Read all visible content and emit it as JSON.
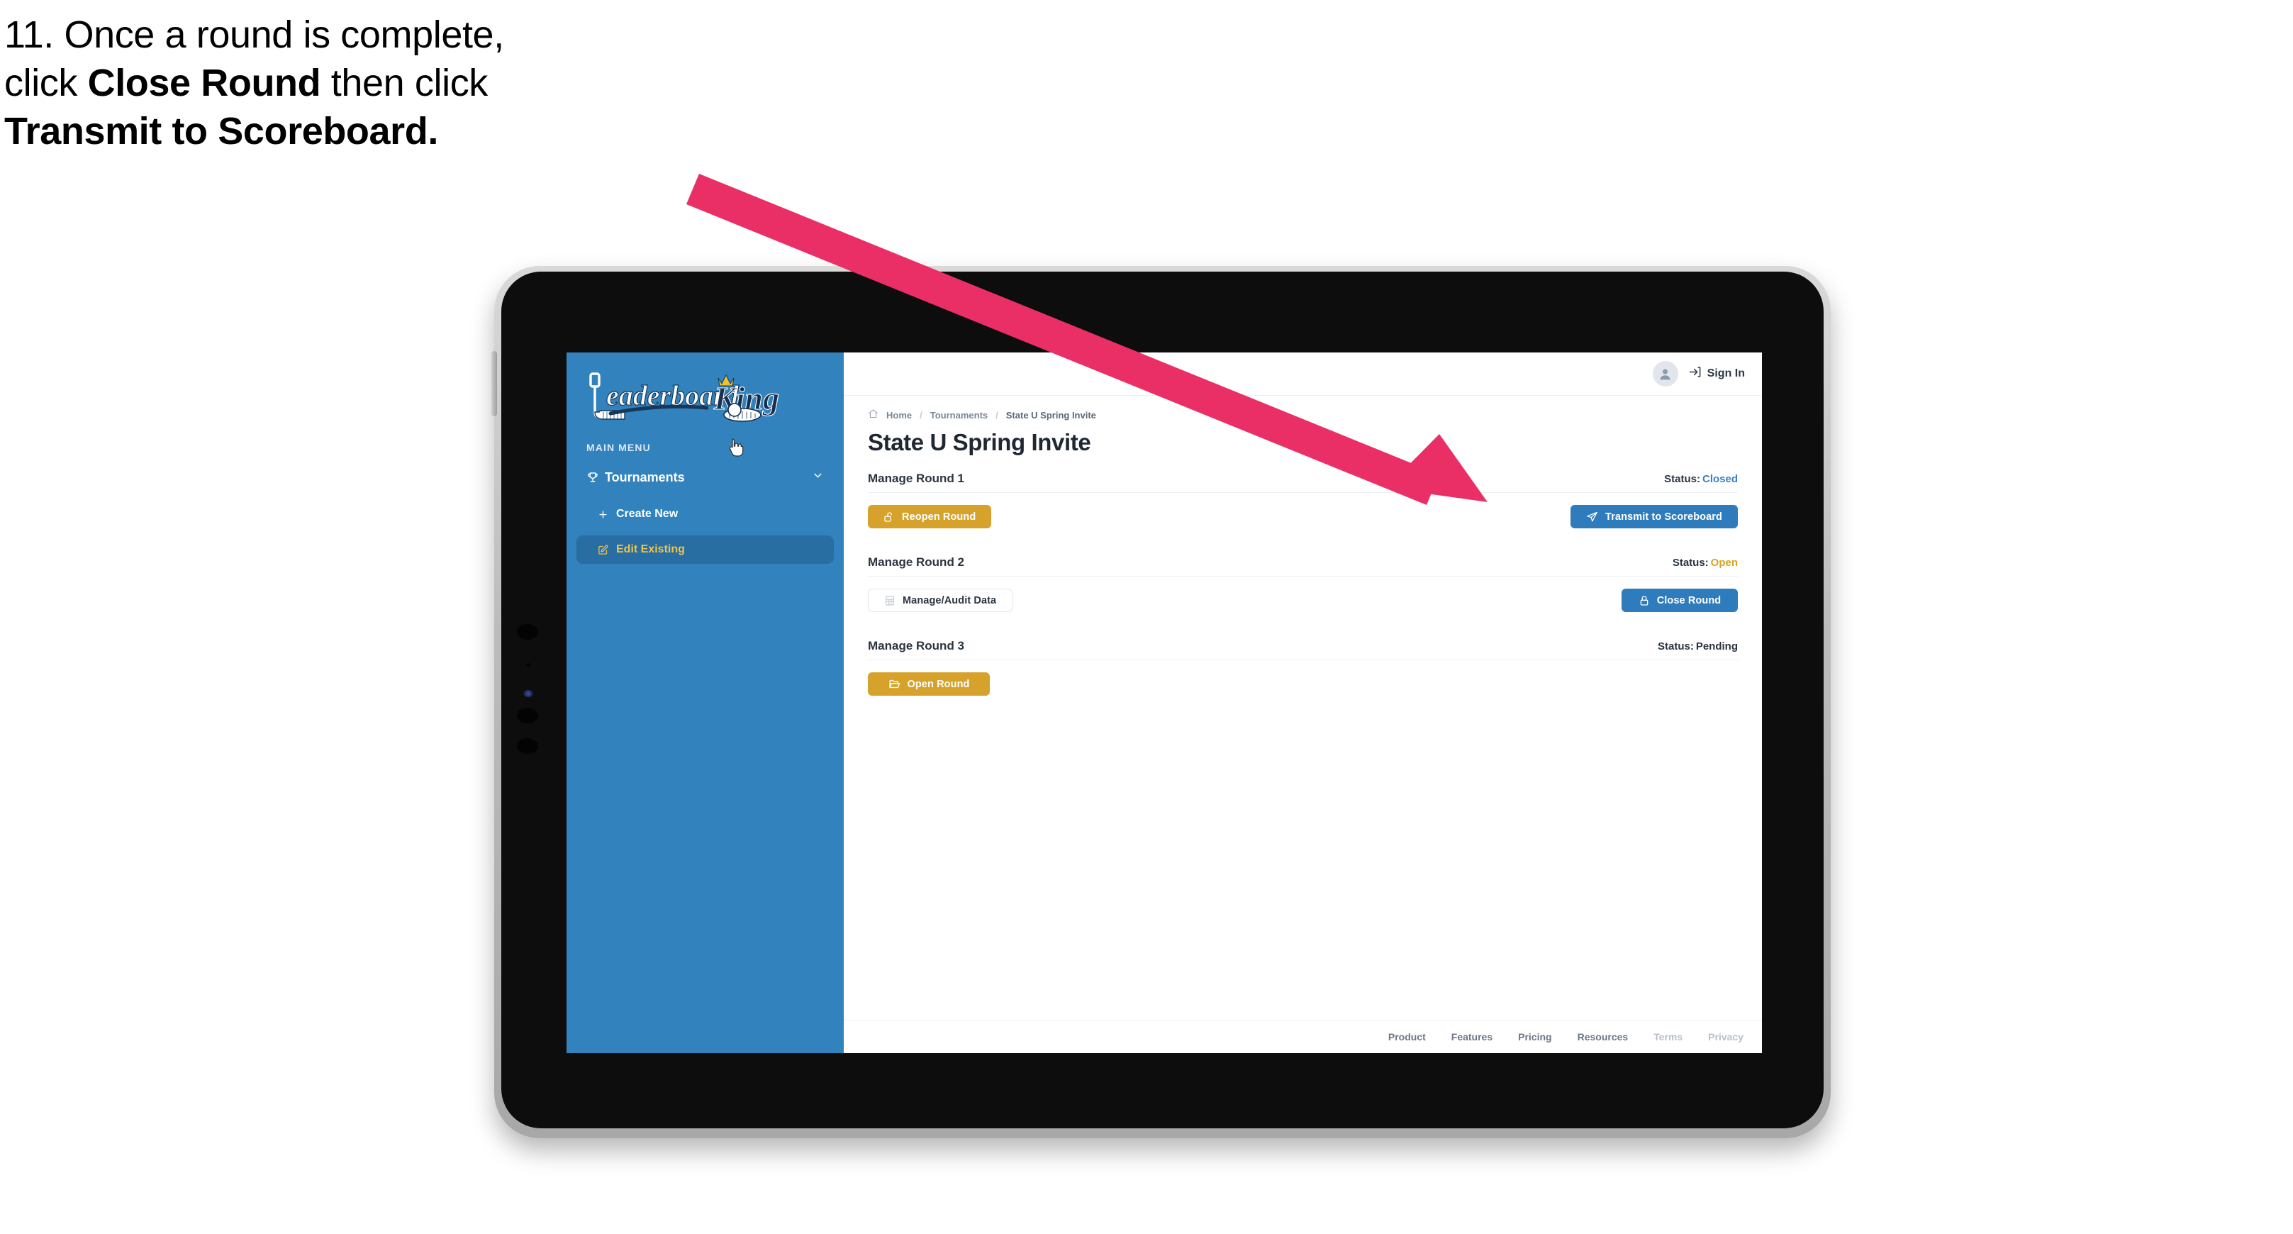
{
  "caption": {
    "line1_plain": "11. Once a round is complete,",
    "line2_pre": "click ",
    "line2_bold": "Close Round",
    "line2_post": " then click",
    "line3_bold": "Transmit to Scoreboard."
  },
  "annotation": {
    "arrow_color": "#ea2f67",
    "arrow_from": "990,250",
    "arrow_to": "2098,708"
  },
  "sidebar": {
    "logo_primary": "Leaderboard",
    "logo_secondary": "King",
    "menu_label": "MAIN MENU",
    "items": [
      {
        "label": "Tournaments",
        "icon": "trophy-icon",
        "chevron": "chevron-down-icon",
        "active": false
      },
      {
        "label": "Create New",
        "icon": "plus-icon",
        "active": false
      },
      {
        "label": "Edit Existing",
        "icon": "edit-square-icon",
        "active": true
      }
    ],
    "bg_color": "#3182bd",
    "active_bg": "#286ea3",
    "active_text": "#f0c24a"
  },
  "topbar": {
    "avatar_icon": "user-avatar-icon",
    "signin_icon": "login-arrow-icon",
    "signin_label": "Sign In"
  },
  "breadcrumb": {
    "home_icon": "home-icon",
    "items": [
      "Home",
      "Tournaments",
      "State U Spring Invite"
    ],
    "separator": "/"
  },
  "page": {
    "title": "State U Spring Invite"
  },
  "rounds": [
    {
      "name": "Manage Round 1",
      "status_label": "Status:",
      "status_value": "Closed",
      "status_class": "st-closed",
      "left_button": {
        "label": "Reopen Round",
        "icon": "unlock-icon",
        "style": "amber"
      },
      "right_button": {
        "label": "Transmit to Scoreboard",
        "icon": "paper-plane-icon",
        "style": "blue"
      }
    },
    {
      "name": "Manage Round 2",
      "status_label": "Status:",
      "status_value": "Open",
      "status_class": "st-open",
      "left_button": {
        "label": "Manage/Audit Data",
        "icon": "table-grid-icon",
        "style": "ghost"
      },
      "right_button": {
        "label": "Close Round",
        "icon": "lock-icon",
        "style": "blue"
      }
    },
    {
      "name": "Manage Round 3",
      "status_label": "Status:",
      "status_value": "Pending",
      "status_class": "st-pending",
      "left_button": {
        "label": "Open Round",
        "icon": "folder-open-icon",
        "style": "amber"
      },
      "right_button": null
    }
  ],
  "footer": {
    "links": [
      {
        "label": "Product",
        "muted": false
      },
      {
        "label": "Features",
        "muted": false
      },
      {
        "label": "Pricing",
        "muted": false
      },
      {
        "label": "Resources",
        "muted": false
      },
      {
        "label": "Terms",
        "muted": true
      },
      {
        "label": "Privacy",
        "muted": true
      }
    ]
  },
  "colors": {
    "amber": "#d6a22c",
    "blue": "#2f7cbc",
    "sidebar_blue": "#3182bd",
    "pink_arrow": "#ea2f67"
  },
  "cursor": {
    "icon": "pointer-hand-cursor"
  }
}
